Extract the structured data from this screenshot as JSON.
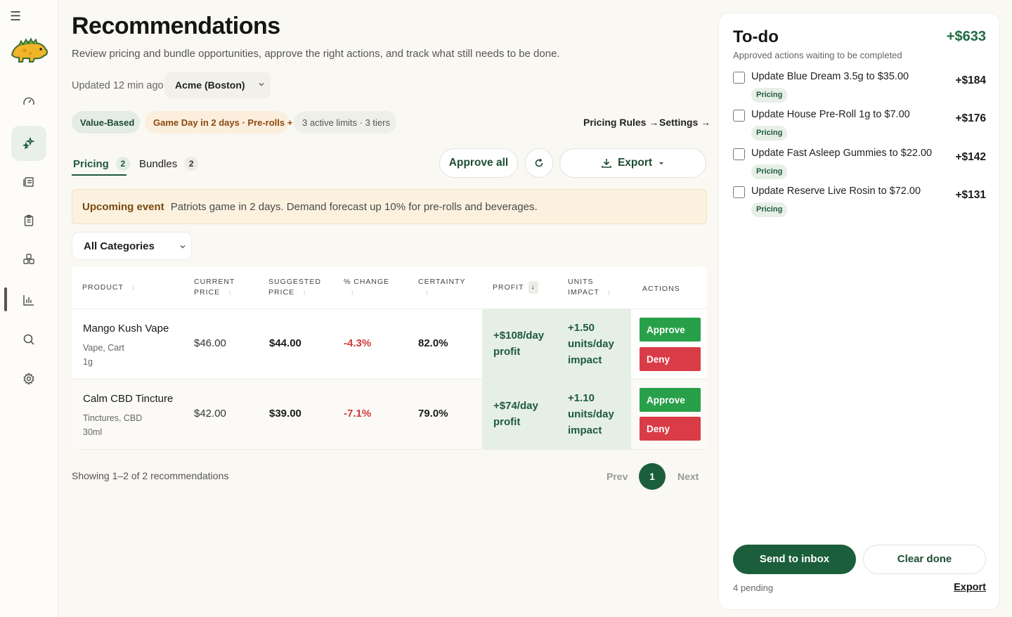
{
  "sidebar": {
    "items": [
      {
        "icon": "dashboard-gauge-icon",
        "active": false
      },
      {
        "icon": "sparkle-recommendations-icon",
        "active": true
      },
      {
        "icon": "catalog-list-icon",
        "active": false
      },
      {
        "icon": "clipboard-icon",
        "active": false
      },
      {
        "icon": "bundles-cubes-icon",
        "active": false
      },
      {
        "icon": "bar-chart-icon",
        "active": false
      },
      {
        "icon": "search-icon",
        "active": false
      },
      {
        "icon": "settings-gear-icon",
        "active": false
      }
    ]
  },
  "header": {
    "title": "Recommendations",
    "subtitle": "Review pricing and bundle opportunities, approve the right actions, and track what still needs to be done.",
    "updated": "Updated 12 min ago",
    "store": "Acme (Boston)"
  },
  "chips": {
    "strategy": "Value-Based",
    "event": "Game Day in 2 days · Pre-rolls +",
    "limits": "3 active limits · 3 tiers"
  },
  "links": {
    "pricing_rules": "Pricing Rules →",
    "settings": "Settings →"
  },
  "tabs": [
    {
      "label": "Pricing",
      "count": "2",
      "active": true
    },
    {
      "label": "Bundles",
      "count": "2",
      "active": false
    }
  ],
  "actions": {
    "approve_all": "Approve all",
    "export": "Export"
  },
  "banner": {
    "label": "Upcoming event",
    "text": "Patriots game in 2 days. Demand forecast up 10% for pre-rolls and beverages."
  },
  "filter": {
    "category": "All Categories"
  },
  "table": {
    "columns": {
      "product": "PRODUCT",
      "current_1": "CURRENT",
      "current_2": "PRICE",
      "suggested_1": "SUGGESTED",
      "suggested_2": "PRICE",
      "change": "% CHANGE",
      "certainty": "CERTAINTY",
      "profit": "PROFIT",
      "units_1": "UNITS",
      "units_2": "IMPACT",
      "actions": "ACTIONS"
    },
    "rows": [
      {
        "name": "Mango Kush Vape",
        "category": "Vape, Cart",
        "size": "1g",
        "current_price": "$46.00",
        "suggested_price": "$44.00",
        "change": "-4.3%",
        "certainty": "82.0%",
        "profit": "+$108/day profit",
        "units": "+1.50 units/day impact",
        "approve": "Approve",
        "deny": "Deny"
      },
      {
        "name": "Calm CBD Tincture",
        "category": "Tinctures, CBD",
        "size": "30ml",
        "current_price": "$42.00",
        "suggested_price": "$39.00",
        "change": "-7.1%",
        "certainty": "79.0%",
        "profit": "+$74/day profit",
        "units": "+1.10 units/day impact",
        "approve": "Approve",
        "deny": "Deny"
      }
    ]
  },
  "pagination": {
    "showing": "Showing 1–2 of 2 recommendations",
    "prev": "Prev",
    "page": "1",
    "next": "Next"
  },
  "todo": {
    "title": "To-do",
    "total": "+$633",
    "subtitle": "Approved actions waiting to be completed",
    "items": [
      {
        "text": "Update Blue Dream 3.5g to $35.00",
        "tag": "Pricing",
        "amount": "+$184",
        "checked": false
      },
      {
        "text": "Update House Pre-Roll 1g to $7.00",
        "tag": "Pricing",
        "amount": "+$176",
        "checked": false
      },
      {
        "text": "Update Fast Asleep Gummies to $22.00",
        "tag": "Pricing",
        "amount": "+$142",
        "checked": false
      },
      {
        "text": "Update Reserve Live Rosin to $72.00",
        "tag": "Pricing",
        "amount": "+$131",
        "checked": false
      }
    ],
    "send": "Send to inbox",
    "clear": "Clear done",
    "pending": "4 pending",
    "export": "Export"
  },
  "colors": {
    "brand_green": "#1b5e3b",
    "approve": "#27a049",
    "deny": "#d93c47",
    "negative": "#d03a3a"
  }
}
